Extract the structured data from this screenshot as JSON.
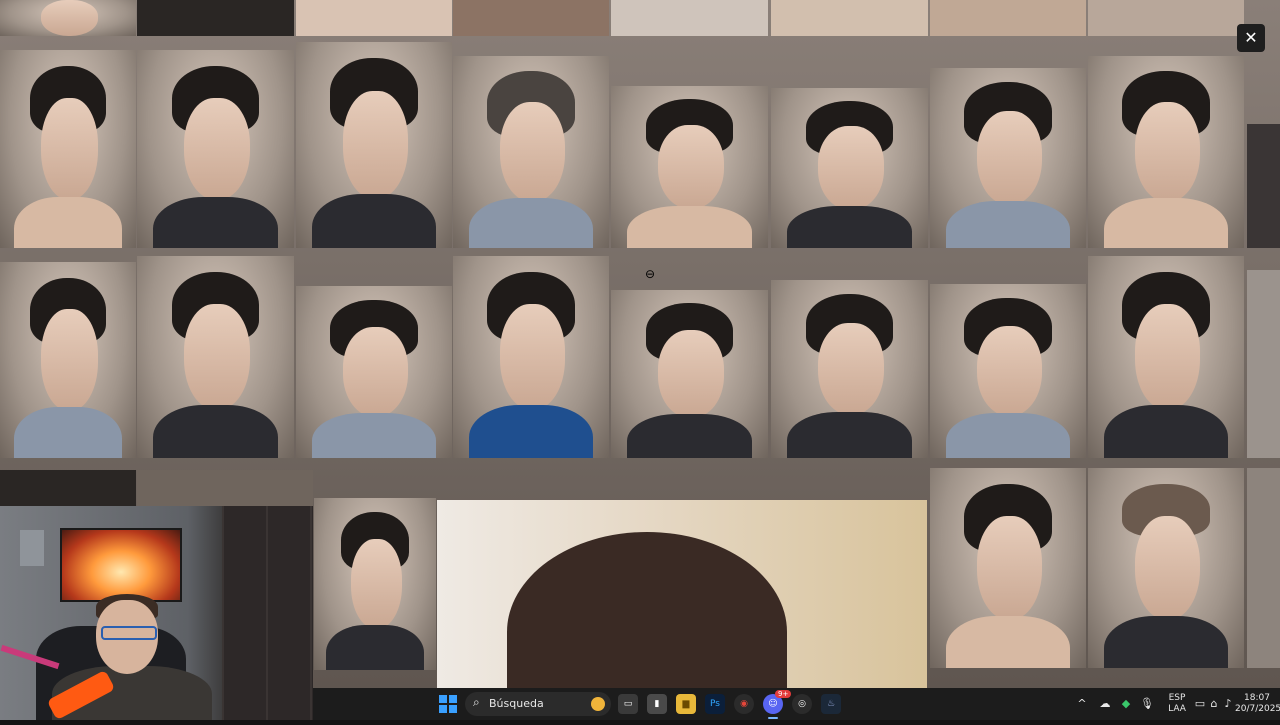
{
  "window": {
    "close_icon": "close-icon",
    "close_glyph": "✕"
  },
  "cursor": {
    "icon": "zoom-out-cursor-icon",
    "glyph": "⊖"
  },
  "mosaic": {
    "description_type": "video-collage-of-faces"
  },
  "taskbar": {
    "search_placeholder": "Búsqueda",
    "apps": [
      {
        "name": "task-view-icon",
        "glyph": "▭"
      },
      {
        "name": "app-icon",
        "glyph": "▮"
      },
      {
        "name": "file-explorer-icon",
        "glyph": "▆"
      },
      {
        "name": "photoshop-icon",
        "label": "Ps"
      },
      {
        "name": "chrome-icon",
        "glyph": "◉"
      },
      {
        "name": "discord-icon",
        "glyph": "☺",
        "badge": "9+"
      },
      {
        "name": "app-icon",
        "glyph": "◎"
      },
      {
        "name": "steam-icon",
        "glyph": "♨"
      }
    ],
    "tray": {
      "chevron": "^",
      "language_line1": "ESP",
      "language_line2": "LAA",
      "time": "18:07",
      "date": "20/7/2025"
    }
  },
  "colors": {
    "taskbar_bg": "#1c1c1c",
    "accent": "#3aa0ff",
    "badge": "#e43b3b"
  }
}
